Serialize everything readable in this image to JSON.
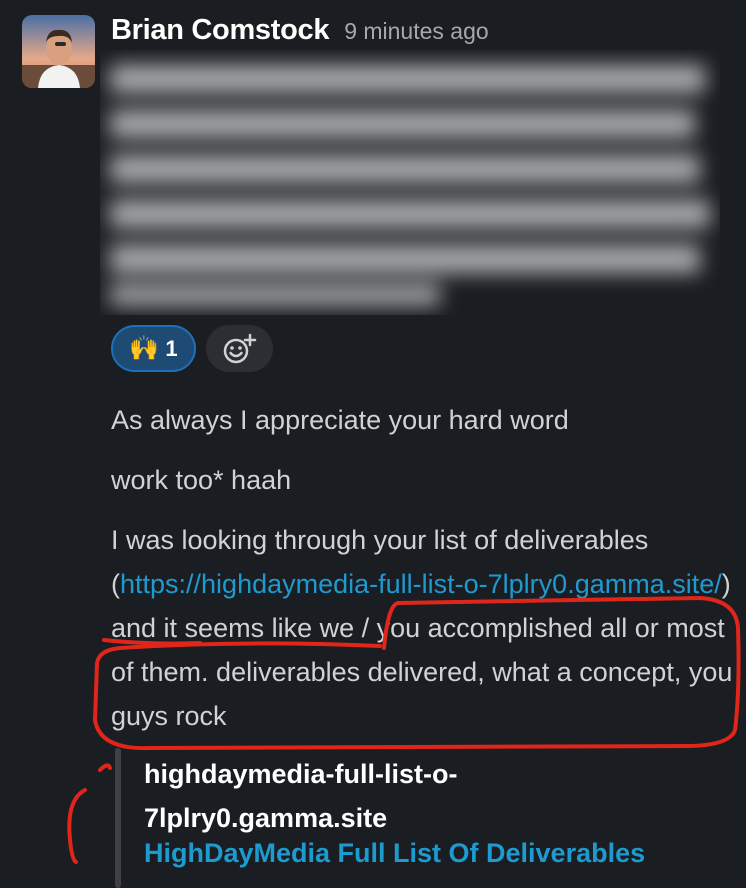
{
  "message": {
    "author": "Brian Comstock",
    "timestamp": "9 minutes ago",
    "reactions": [
      {
        "emoji": "🙌",
        "count": "1"
      }
    ]
  },
  "replies": {
    "line1": "As always I appreciate your hard word",
    "line2": "work too* haah",
    "line3_before": "I was looking through your list of deliverables (",
    "line3_link": "https://highdaymedia-full-list-o-7lplry0.gamma.site/",
    "line3_after": ") and it seems like we / you accomplished all or most of them. deliverables delivered, what a concept, you guys rock"
  },
  "unfurl": {
    "site": "highdaymedia-full-list-o-7lplry0.gamma.site",
    "title": "HighDayMedia Full List Of Deliverables"
  },
  "colors": {
    "background": "#1a1d21",
    "link": "#1d9bd1",
    "reaction_bg": "#1e4b73",
    "annotation": "#e0261a"
  }
}
